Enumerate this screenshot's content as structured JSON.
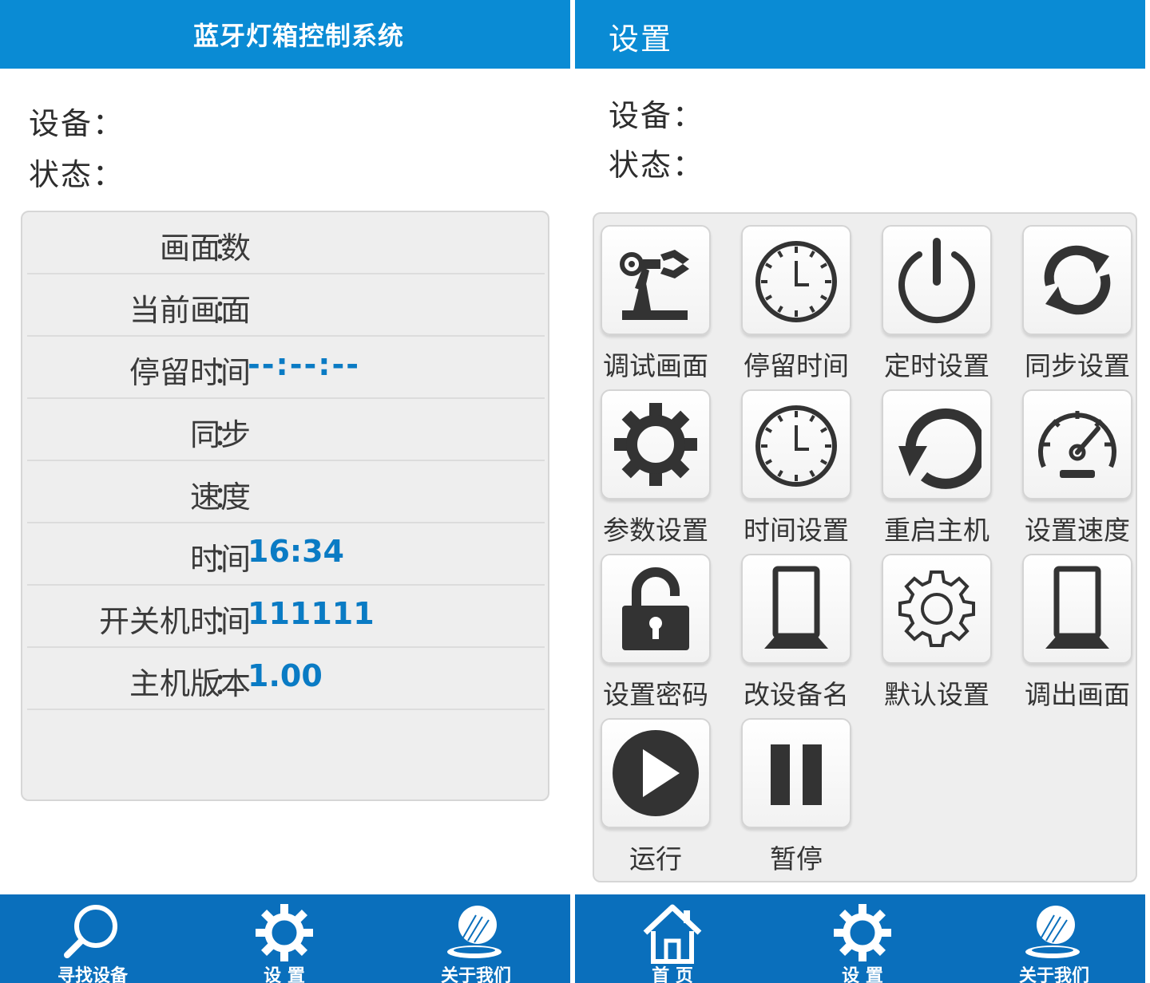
{
  "left": {
    "title": "蓝牙灯箱控制系统",
    "device_label": "设备：",
    "status_label": "状态：",
    "rows": [
      {
        "label": "画面数",
        "value": ""
      },
      {
        "label": "当前画面",
        "value": ""
      },
      {
        "label": "停留时间",
        "value": "--:--:--"
      },
      {
        "label": "同步",
        "value": ""
      },
      {
        "label": "速度",
        "value": ""
      },
      {
        "label": "时间",
        "value": "16:34"
      },
      {
        "label": "开关机时间",
        "value": "111111"
      },
      {
        "label": "主机版本",
        "value": "1.00"
      }
    ],
    "colon": "：",
    "nav": [
      {
        "label": "寻找设备",
        "icon": "search-icon"
      },
      {
        "label": "设 置",
        "icon": "gear-icon"
      },
      {
        "label": "关于我们",
        "icon": "globe-icon"
      }
    ]
  },
  "right": {
    "title": "设置",
    "device_label": "设备：",
    "status_label": "状态：",
    "tiles": [
      {
        "label": "调试画面",
        "icon": "robot-arm-icon"
      },
      {
        "label": "停留时间",
        "icon": "clock-icon"
      },
      {
        "label": "定时设置",
        "icon": "power-icon"
      },
      {
        "label": "同步设置",
        "icon": "sync-icon"
      },
      {
        "label": "参数设置",
        "icon": "gear-icon"
      },
      {
        "label": "时间设置",
        "icon": "clock-icon"
      },
      {
        "label": "重启主机",
        "icon": "restart-icon"
      },
      {
        "label": "设置速度",
        "icon": "speedometer-icon"
      },
      {
        "label": "设置密码",
        "icon": "unlock-icon"
      },
      {
        "label": "改设备名",
        "icon": "lightbox-icon"
      },
      {
        "label": "默认设置",
        "icon": "gear-outline-icon"
      },
      {
        "label": "调出画面",
        "icon": "lightbox-icon"
      },
      {
        "label": "运行",
        "icon": "play-icon"
      },
      {
        "label": "暂停",
        "icon": "pause-icon"
      }
    ],
    "nav": [
      {
        "label": "首 页",
        "icon": "home-icon"
      },
      {
        "label": "设 置",
        "icon": "gear-icon"
      },
      {
        "label": "关于我们",
        "icon": "globe-icon"
      }
    ]
  },
  "colors": {
    "title_bar": "#0a8bd4",
    "bottom_bar": "#0a6fbc",
    "value_text": "#0a7bc4",
    "icon": "#333333"
  }
}
